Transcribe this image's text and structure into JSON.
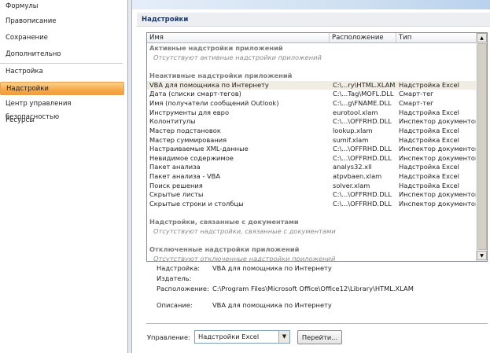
{
  "sidebar": {
    "items": [
      {
        "label": "Формулы",
        "active": false
      },
      {
        "label": "Правописание",
        "active": false
      },
      {
        "label": "Сохранение",
        "active": false
      },
      {
        "label": "Дополнительно",
        "active": false
      },
      {
        "label": "Настройка",
        "active": false
      },
      {
        "label": "Надстройки",
        "active": true
      },
      {
        "label": "Центр управления безопасностью",
        "active": false
      },
      {
        "label": "Ресурсы",
        "active": false
      }
    ]
  },
  "section_title": "Надстройки",
  "list": {
    "columns": [
      "Имя",
      "Расположение",
      "Тип"
    ],
    "groups": [
      {
        "title": "Активные надстройки приложений",
        "empty": "Отсутствуют активные надстройки приложений",
        "rows": []
      },
      {
        "title": "Неактивные надстройки приложений",
        "empty": null,
        "rows": [
          [
            "VBA для помощника по Интернету",
            "C:\\...ry\\HTML.XLAM",
            "Надстройка Excel"
          ],
          [
            "Дата (списки смарт-тегов)",
            "C:\\...Tag\\MOFL.DLL",
            "Смарт-тег"
          ],
          [
            "Имя (получатели сообщений Outlook)",
            "C:\\...g\\FNAME.DLL",
            "Смарт-тег"
          ],
          [
            "Инструменты для евро",
            "eurotool.xlam",
            "Надстройка Excel"
          ],
          [
            "Колонтитулы",
            "C:\\...\\OFFRHD.DLL",
            "Инспектор документов"
          ],
          [
            "Мастер подстановок",
            "lookup.xlam",
            "Надстройка Excel"
          ],
          [
            "Мастер суммирования",
            "sumif.xlam",
            "Надстройка Excel"
          ],
          [
            "Настраиваемые XML-данные",
            "C:\\...\\OFFRHD.DLL",
            "Инспектор документов"
          ],
          [
            "Невидимое содержимое",
            "C:\\...\\OFFRHD.DLL",
            "Инспектор документов"
          ],
          [
            "Пакет анализа",
            "analys32.xll",
            "Надстройка Excel"
          ],
          [
            "Пакет анализа - VBA",
            "atpvbaen.xlam",
            "Надстройка Excel"
          ],
          [
            "Поиск решения",
            "solver.xlam",
            "Надстройка Excel"
          ],
          [
            "Скрытые листы",
            "C:\\...\\OFFRHD.DLL",
            "Инспектор документов"
          ],
          [
            "Скрытые строки и столбцы",
            "C:\\...\\OFFRHD.DLL",
            "Инспектор документов"
          ]
        ]
      },
      {
        "title": "Надстройки, связанные с документами",
        "empty": "Отсутствуют надстройки, связанные с документами",
        "rows": []
      },
      {
        "title": "Отключенные надстройки приложений",
        "empty": "Отсутствуют отключенные надстройки приложений",
        "rows": []
      }
    ],
    "selected_index": 0
  },
  "details": {
    "addin_label": "Надстройка:",
    "addin_value": "VBA для помощника по Интернету",
    "publisher_label": "Издатель:",
    "location_label": "Расположение:",
    "location_value": "C:\\Program Files\\Microsoft Office\\Office12\\Library\\HTML.XLAM",
    "description_label": "Описание:",
    "description_value": "VBA для помощника по Интернету"
  },
  "manage": {
    "label": "Управление:",
    "selected": "Надстройки Excel",
    "go_button": "Перейти..."
  }
}
